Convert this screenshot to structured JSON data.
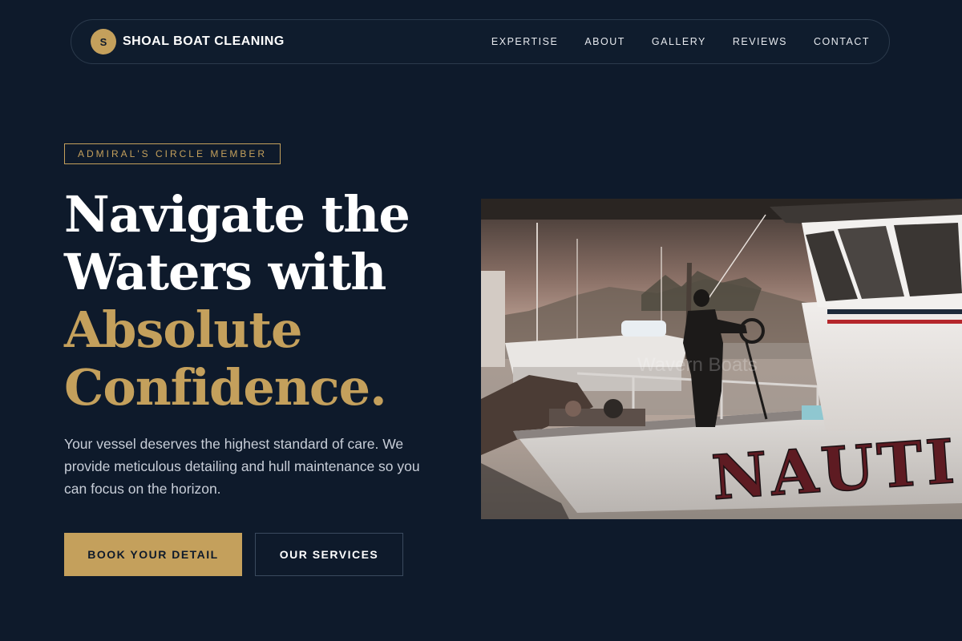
{
  "brand": {
    "initial": "S",
    "name": "SHOAL BOAT CLEANING"
  },
  "nav": {
    "links": [
      "EXPERTISE",
      "ABOUT",
      "GALLERY",
      "REVIEWS",
      "CONTACT"
    ]
  },
  "hero": {
    "badge": "ADMIRAL'S CIRCLE MEMBER",
    "headline_white": [
      "Navigate the",
      "Waters with"
    ],
    "headline_gold": [
      "Absolute",
      "Confidence."
    ],
    "lead": "Your vessel deserves the highest standard of care. We provide meticulous detailing and hull maintenance so you can focus on the horizon.",
    "primary_button": "BOOK YOUR DETAIL",
    "secondary_button": "OUR SERVICES"
  },
  "image": {
    "hull_text": "NAUTI",
    "watermark": "Wavern Boats"
  },
  "colors": {
    "background": "#0e1a2b",
    "accent_gold": "#c4a05c",
    "text_muted": "#c8ced8",
    "border": "#2b3a4c"
  },
  "icons": {
    "brand_badge": "letter-circle-icon"
  }
}
